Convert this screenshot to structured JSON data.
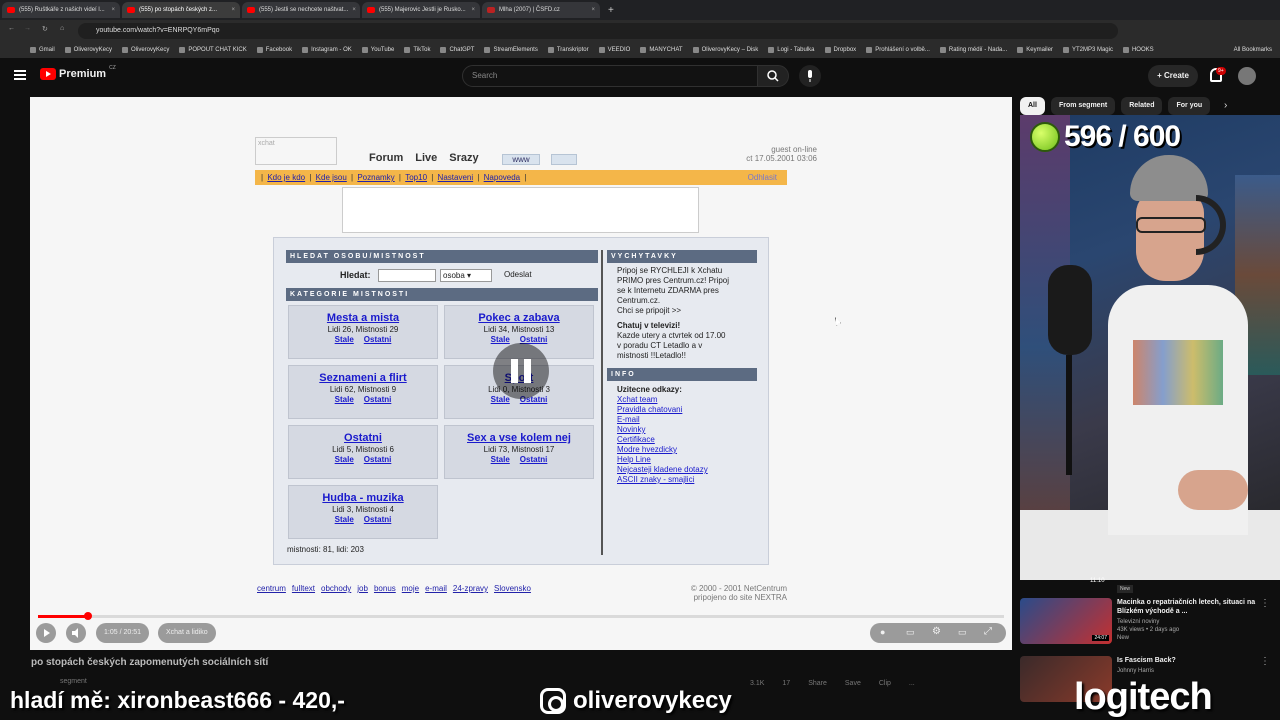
{
  "browser": {
    "tabs": [
      {
        "title": "(555) Ruštkáře z našich videí l..."
      },
      {
        "title": "(555) po stopách českých z..."
      },
      {
        "title": "(555) Jestli se nechcete naštvat..."
      },
      {
        "title": "(555) Majerovic Jestli je Rusko..."
      },
      {
        "title": "Mlha (2007) | ČSFD.cz"
      }
    ],
    "new_tab": "+",
    "url": "youtube.com/watch?v=ENRPQY6mPqo",
    "bookmarks": [
      "Gmail",
      "OliverovyKecy",
      "OliverovyKecy",
      "POPOUT CHAT KICK",
      "Facebook",
      "Instagram - OK",
      "YouTube",
      "TikTok",
      "ChatGPT",
      "StreamElements",
      "Transkriptor",
      "VEEDIO",
      "MANYCHAT",
      "OliverovyKecy – Disk",
      "Logi - Tabulka",
      "Dropbox",
      "Prohlášení o volbě...",
      "Rating médií - Nada...",
      "Keymailer",
      "YT2MP3 Magic",
      "HOOKS"
    ],
    "all_bookmarks": "All Bookmarks"
  },
  "youtube": {
    "logo": "Premium",
    "logo_region": "CZ",
    "search_placeholder": "Search",
    "create": "Create",
    "notif_badge": "9+"
  },
  "site": {
    "logo_alt": "xchat",
    "nav": [
      "Forum",
      "Live",
      "Srazy"
    ],
    "www": "www",
    "guest_line1": "guest on-line",
    "guest_line2": "ct 17.05.2001 03:06",
    "menu": [
      "Kdo je kdo",
      "Kde jsou",
      "Poznamky",
      "Top10",
      "Nastaveni",
      "Napoveda"
    ],
    "logout": "Odhlasit",
    "search_header": "HLEDAT OSOBU/MISTNOST",
    "search_label": "Hledat:",
    "select_value": "osoba",
    "send": "Odeslat",
    "categories_header": "KATEGORIE MISTNOSTI",
    "categories": [
      {
        "name": "Mesta a mista",
        "counts": "Lidi 26, Mistnosti 29"
      },
      {
        "name": "Pokec a zabava",
        "counts": "Lidi 34, Mistnosti 13"
      },
      {
        "name": "Seznameni a flirt",
        "counts": "Lidi 62, Mistnosti 9"
      },
      {
        "name": "Sport",
        "counts": "Lidi 0, Mistnosti 3"
      },
      {
        "name": "Ostatni",
        "counts": "Lidi 5, Mistnosti 6"
      },
      {
        "name": "Sex a vse kolem nej",
        "counts": "Lidi 73, Mistnosti 17"
      },
      {
        "name": "Hudba - muzika",
        "counts": "Lidi 3, Mistnosti 4"
      }
    ],
    "link_stale": "Stale",
    "link_ostatni": "Ostatni",
    "totals": "mistnosti: 81, lidi: 203",
    "vychytavky_header": "VYCHYTAVKY",
    "vychytavky_lines": [
      "Pripoj se RYCHLEJI k Xchatu",
      "PRIMO pres Centrum.cz! Pripoj",
      "se k Internetu ZDARMA pres",
      "Centrum.cz.",
      "Chci se pripojit >>"
    ],
    "tv_title": "Chatuj v televizi!",
    "tv_lines": [
      "Kazde utery a ctvrtek od 17.00",
      "v poradu CT Letadlo a v",
      "mistnosti !!Letadlo!!"
    ],
    "info_header": "INFO",
    "info_title": "Uzitecne odkazy:",
    "info_links": [
      "Xchat team",
      "Pravidla chatovani",
      "E-mail",
      "Novinky",
      "Certifikace",
      "Modre hvezdicky",
      "Help Line",
      "Nejcasteji kladene dotazy",
      "ASCII znaky - smajlici"
    ],
    "footer_links": [
      "centrum",
      "fulltext",
      "obchody",
      "job",
      "bonus",
      "moje",
      "e-mail",
      "24-zpravy",
      "Slovensko"
    ],
    "copyright1": "© 2000 - 2001 NetCentrum",
    "copyright2": "pripojeno do site NEXTRA"
  },
  "player": {
    "time": "1:05 / 20:51",
    "chapter": "Xchat a lidiko",
    "progress_fraction": 0.052
  },
  "video": {
    "title": "po stopách českých zapomenutých sociálních sítí",
    "segment": "segment",
    "actions": [
      "3.1K",
      "17",
      "Share",
      "Save",
      "Clip",
      "..."
    ]
  },
  "sidebar": {
    "chips": [
      "All",
      "From segment",
      "Related",
      "For you"
    ],
    "counter": "596 / 600",
    "recs": [
      {
        "title": "Macinka o repatriačních letech, situaci na Blízkém východě a ...",
        "channel": "Televizní noviny",
        "meta": "43K views • 2 days ago",
        "badge": "New",
        "duration": "24:07"
      },
      {
        "title": "Is Fascism Back?",
        "channel": "Johnny Harris",
        "meta": "",
        "badge": "",
        "duration": ""
      }
    ],
    "prev_duration": "11:10",
    "prev_badge": "New"
  },
  "overlay": {
    "left": "hladí mě: xironbeast666 - 420,-",
    "mid": "oliverovykecy",
    "right": "logitech"
  },
  "colors": {
    "yt_red": "#ff0000",
    "menu_orange": "#f4b649",
    "header_slate": "#5c6b82",
    "link_blue": "#1a1acc"
  }
}
